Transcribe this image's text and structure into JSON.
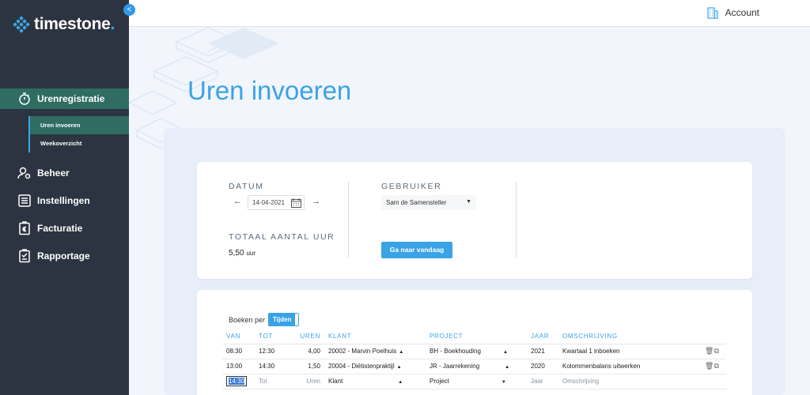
{
  "brand": {
    "name": "timestone",
    "dot": "."
  },
  "sidebar": {
    "collapse": "<",
    "items": [
      {
        "label": "Urenregistratie",
        "icon": "stopwatch-icon"
      },
      {
        "label": "Beheer",
        "icon": "user-gear-icon"
      },
      {
        "label": "Instellingen",
        "icon": "settings-panel-icon"
      },
      {
        "label": "Facturatie",
        "icon": "invoice-euro-icon"
      },
      {
        "label": "Rapportage",
        "icon": "report-icon"
      }
    ],
    "sub_items": [
      {
        "label": "Uren invoeren"
      },
      {
        "label": "Weekoverzicht"
      }
    ]
  },
  "topbar": {
    "account_label": "Account"
  },
  "page": {
    "title": "Uren invoeren"
  },
  "filters": {
    "datum_label": "DATUM",
    "datum_value": "14-04-2021",
    "gebruiker_label": "GEBRUIKER",
    "gebruiker_value": "Sam de Samensteller",
    "totaal_label": "TOTAAL AANTAL UUR",
    "totaal_value": "5,50",
    "totaal_unit": "uur",
    "today_button": "Ga naar vandaag"
  },
  "entries": {
    "boeken_per_label": "Boeken per",
    "boeken_per_value": "Tijden",
    "columns": {
      "van": "VAN",
      "tot": "TOT",
      "uren": "UREN",
      "klant": "KLANT",
      "project": "PROJECT",
      "jaar": "JAAR",
      "omschrijving": "OMSCHRIJVING"
    },
    "rows": [
      {
        "van": "08:30",
        "tot": "12:30",
        "uren": "4,00",
        "klant": "20002 - Marvin Poelhuis",
        "project": "BH - Boekhouding",
        "jaar": "2021",
        "omschrijving": "Kwartaal 1 inboeken"
      },
      {
        "van": "13:00",
        "tot": "14:30",
        "uren": "1,50",
        "klant": "20004 - Diëtistenpraktijl",
        "project": "JR - Jaarrekening",
        "jaar": "2020",
        "omschrijving": "Kolommenbalans uitwerken"
      }
    ],
    "new_row": {
      "van": "14:30",
      "tot": "Tot",
      "uren": "Uren",
      "klant": "Klant",
      "project": "Project",
      "jaar": "Jaar",
      "omschrijving": "Omschrijving"
    }
  },
  "colors": {
    "sidebar": "#2b3440",
    "active": "#2f6c62",
    "accent": "#3aa3e6"
  }
}
